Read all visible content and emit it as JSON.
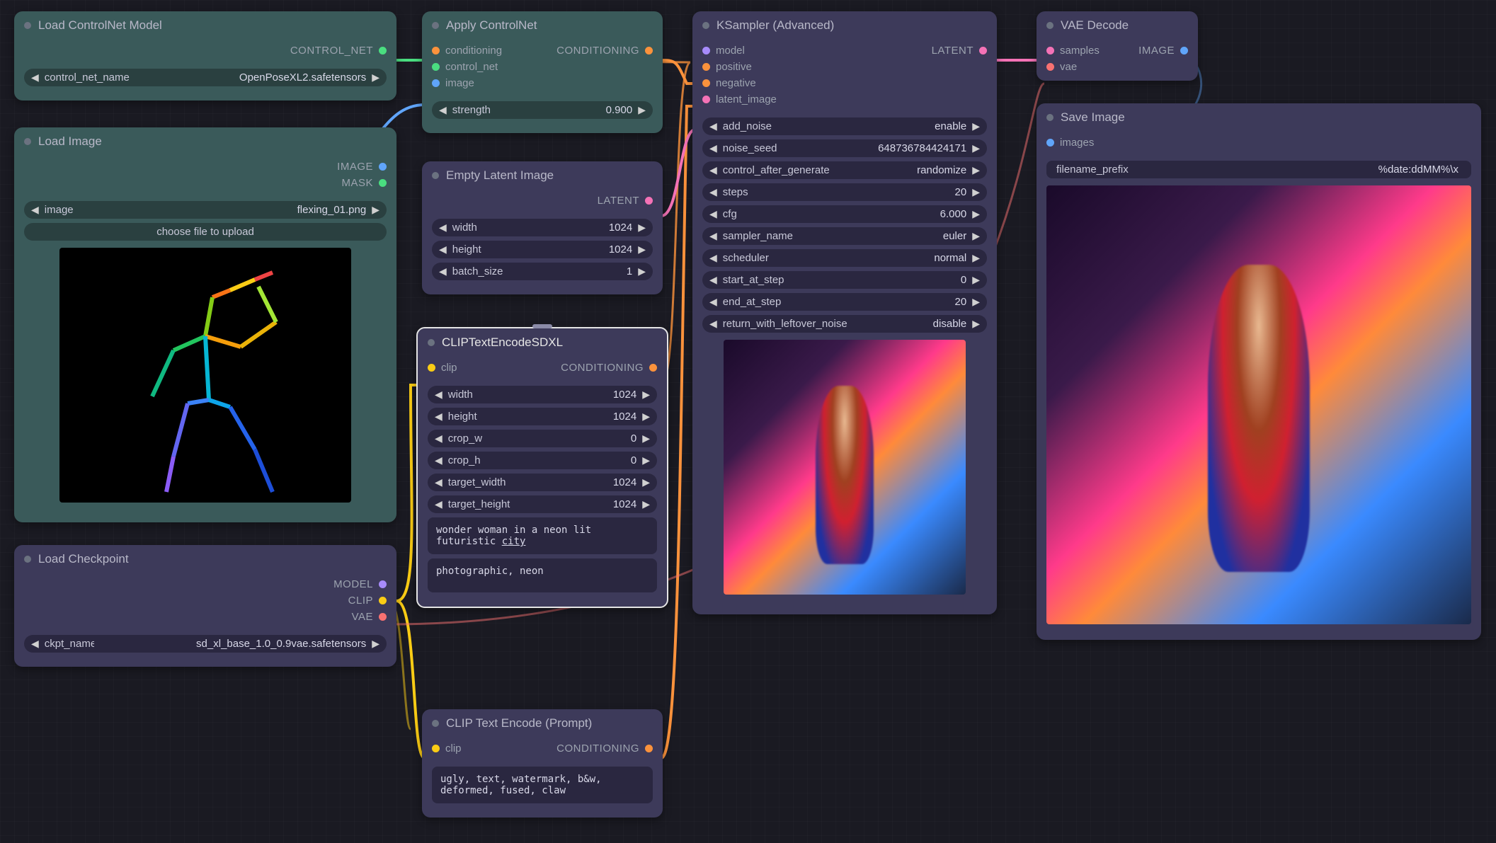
{
  "nodes": {
    "load_controlnet": {
      "title": "Load ControlNet Model",
      "outputs": {
        "control_net": "CONTROL_NET"
      },
      "widgets": {
        "control_net_name": {
          "label": "control_net_name",
          "value": "OpenPoseXL2.safetensors"
        }
      }
    },
    "load_image": {
      "title": "Load Image",
      "outputs": {
        "image": "IMAGE",
        "mask": "MASK"
      },
      "widgets": {
        "image": {
          "label": "image",
          "value": "flexing_01.png"
        },
        "upload_button": "choose file to upload"
      }
    },
    "load_checkpoint": {
      "title": "Load Checkpoint",
      "outputs": {
        "model": "MODEL",
        "clip": "CLIP",
        "vae": "VAE"
      },
      "widgets": {
        "ckpt_name": {
          "label": "ckpt_name",
          "value": "sd_xl_base_1.0_0.9vae.safetensors"
        }
      }
    },
    "apply_controlnet": {
      "title": "Apply ControlNet",
      "inputs": {
        "conditioning": "conditioning",
        "control_net": "control_net",
        "image": "image"
      },
      "outputs": {
        "conditioning": "CONDITIONING"
      },
      "widgets": {
        "strength": {
          "label": "strength",
          "value": "0.900"
        }
      }
    },
    "empty_latent": {
      "title": "Empty Latent Image",
      "outputs": {
        "latent": "LATENT"
      },
      "widgets": {
        "width": {
          "label": "width",
          "value": "1024"
        },
        "height": {
          "label": "height",
          "value": "1024"
        },
        "batch_size": {
          "label": "batch_size",
          "value": "1"
        }
      }
    },
    "clip_sdxl": {
      "title": "CLIPTextEncodeSDXL",
      "inputs": {
        "clip": "clip"
      },
      "outputs": {
        "conditioning": "CONDITIONING"
      },
      "widgets": {
        "width": {
          "label": "width",
          "value": "1024"
        },
        "height": {
          "label": "height",
          "value": "1024"
        },
        "crop_w": {
          "label": "crop_w",
          "value": "0"
        },
        "crop_h": {
          "label": "crop_h",
          "value": "0"
        },
        "target_width": {
          "label": "target_width",
          "value": "1024"
        },
        "target_height": {
          "label": "target_height",
          "value": "1024"
        }
      },
      "text_g_pre": "wonder woman in a neon lit\nfuturistic ",
      "text_g_underline": "city",
      "text_l": "photographic, neon"
    },
    "clip_neg": {
      "title": "CLIP Text Encode (Prompt)",
      "inputs": {
        "clip": "clip"
      },
      "outputs": {
        "conditioning": "CONDITIONING"
      },
      "text": "ugly, text, watermark, b&w, deformed, fused, claw"
    },
    "ksampler": {
      "title": "KSampler (Advanced)",
      "inputs": {
        "model": "model",
        "positive": "positive",
        "negative": "negative",
        "latent_image": "latent_image"
      },
      "outputs": {
        "latent": "LATENT"
      },
      "widgets": {
        "add_noise": {
          "label": "add_noise",
          "value": "enable"
        },
        "noise_seed": {
          "label": "noise_seed",
          "value": "648736784424171"
        },
        "control_after_generate": {
          "label": "control_after_generate",
          "value": "randomize"
        },
        "steps": {
          "label": "steps",
          "value": "20"
        },
        "cfg": {
          "label": "cfg",
          "value": "6.000"
        },
        "sampler_name": {
          "label": "sampler_name",
          "value": "euler"
        },
        "scheduler": {
          "label": "scheduler",
          "value": "normal"
        },
        "start_at_step": {
          "label": "start_at_step",
          "value": "0"
        },
        "end_at_step": {
          "label": "end_at_step",
          "value": "20"
        },
        "return_with_leftover_noise": {
          "label": "return_with_leftover_noise",
          "value": "disable"
        }
      }
    },
    "vae_decode": {
      "title": "VAE Decode",
      "inputs": {
        "samples": "samples",
        "vae": "vae"
      },
      "outputs": {
        "image": "IMAGE"
      }
    },
    "save_image": {
      "title": "Save Image",
      "inputs": {
        "images": "images"
      },
      "widgets": {
        "filename_prefix": {
          "label": "filename_prefix",
          "value": "%date:ddMM%\\x"
        }
      }
    }
  },
  "colors": {
    "model": "#a78bfa",
    "conditioning": "#fb923c",
    "latent": "#f472b6",
    "image": "#60a5fa",
    "vae": "#f87171",
    "clip": "#facc15",
    "control_net": "#4ade80",
    "mask": "#4ade80"
  }
}
